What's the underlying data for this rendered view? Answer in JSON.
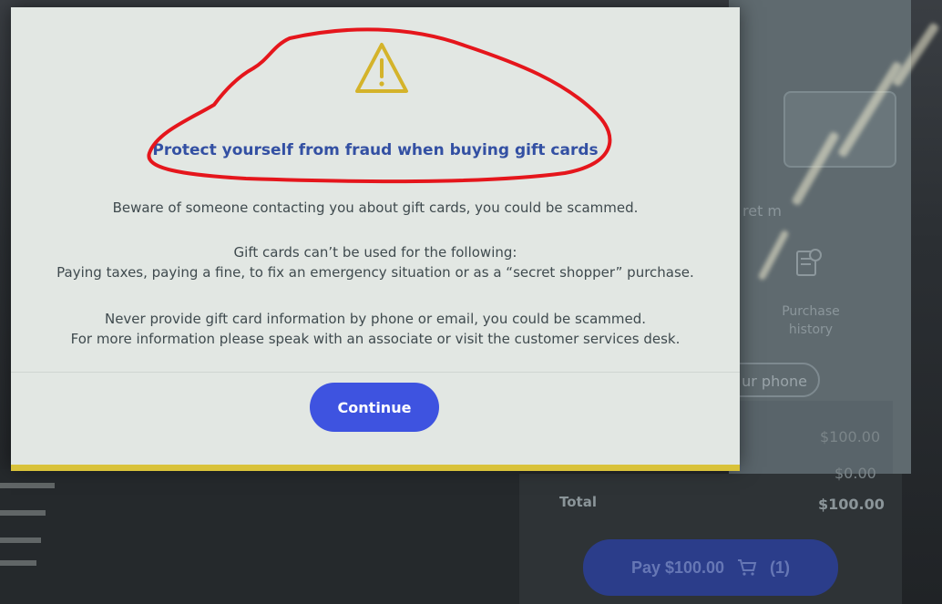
{
  "modal": {
    "title": "Protect yourself from fraud when buying gift cards",
    "paragraph1": "Beware of someone contacting you about gift cards, you could be scammed.",
    "paragraph2_line1": "Gift cards can’t be used for the following:",
    "paragraph2_line2": "Paying taxes, paying a fine, to fix an emergency situation or as a “secret shopper” purchase.",
    "paragraph3_line1": "Never provide gift card information by phone or email, you could be scammed.",
    "paragraph3_line2": "For more information please speak with an associate or visit the customer services desk.",
    "continue_label": "Continue",
    "title_color": "#3350a3",
    "button_color": "#3e53e0",
    "warning_color": "#d4b32a",
    "accent_bar_color": "#d9c23a"
  },
  "background": {
    "side_hint": "ret m",
    "purchase_history_line1": "Purchase",
    "purchase_history_line2": "history",
    "phone_button_label": "ur phone",
    "subtotal_value": "$100.00",
    "tax_value": "$0.00",
    "total_label": "Total",
    "total_value": "$100.00",
    "pay_button_label": "Pay $100.00",
    "cart_count": "(1)"
  },
  "annotation": {
    "color": "#e5161c"
  }
}
